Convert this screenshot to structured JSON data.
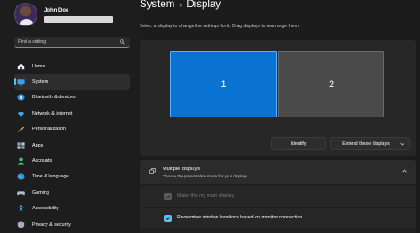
{
  "profile": {
    "name": "John Doe"
  },
  "search": {
    "placeholder": "Find a setting"
  },
  "sidebar": {
    "items": [
      {
        "label": "Home",
        "icon": "home-icon"
      },
      {
        "label": "System",
        "icon": "system-icon",
        "active": true
      },
      {
        "label": "Bluetooth & devices",
        "icon": "bluetooth-icon"
      },
      {
        "label": "Network & internet",
        "icon": "network-icon"
      },
      {
        "label": "Personalization",
        "icon": "brush-icon"
      },
      {
        "label": "Apps",
        "icon": "apps-icon"
      },
      {
        "label": "Accounts",
        "icon": "accounts-icon"
      },
      {
        "label": "Time & language",
        "icon": "globe-icon"
      },
      {
        "label": "Gaming",
        "icon": "gamepad-icon"
      },
      {
        "label": "Accessibility",
        "icon": "accessibility-icon"
      },
      {
        "label": "Privacy & security",
        "icon": "shield-icon"
      }
    ]
  },
  "header": {
    "section": "System",
    "separator": "›",
    "page": "Display",
    "subtitle": "Select a display to change the settings for it. Drag displays to rearrange them."
  },
  "displays": {
    "monitor_1": "1",
    "monitor_2": "2",
    "identify_label": "Identify",
    "extend_label": "Extend these displays"
  },
  "multiple_displays": {
    "title": "Multiple displays",
    "description": "Choose the presentation mode for your displays",
    "options": [
      {
        "label": "Make this my main display",
        "checked": true,
        "disabled": true
      },
      {
        "label": "Remember window locations based on monitor connection",
        "checked": true,
        "disabled": false
      }
    ]
  },
  "colors": {
    "accent": "#4cc2ff",
    "selected_monitor": "#0a72d0",
    "background": "#1c1c1c"
  }
}
